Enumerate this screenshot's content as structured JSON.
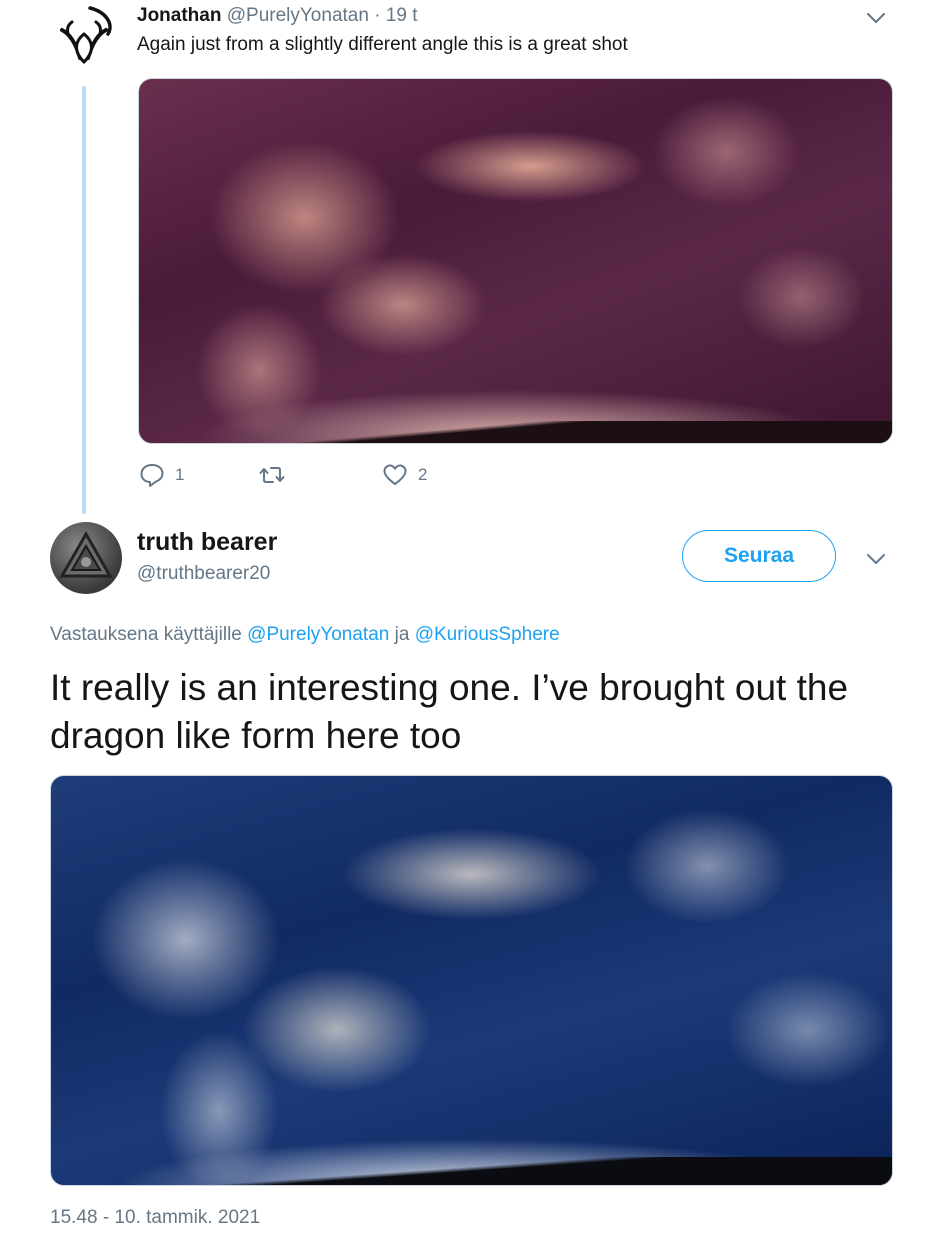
{
  "parent_tweet": {
    "name": "Jonathan",
    "handle": "@PurelyYonatan",
    "separator": "·",
    "time": "19 t",
    "text": "Again just from a slightly different angle this is a great shot",
    "reply_count": "1",
    "like_count": "2",
    "media_subject": "sky photograph of wispy clouds"
  },
  "reply_tweet": {
    "name": "truth bearer",
    "handle": "@truthbearer20",
    "follow_label": "Seuraa",
    "reply_to_prefix": "Vastauksena käyttäjille",
    "reply_to_mention_1": "@PurelyYonatan",
    "reply_to_joiner": "ja",
    "reply_to_mention_2": "@KuriousSphere",
    "text": "It really is an interesting one. I’ve brought out the dragon like form here too",
    "timestamp": "15.48 - 10. tammik. 2021",
    "media_subject": "sky photograph of wispy clouds"
  },
  "colors": {
    "accent": "#1da1f2",
    "secondary_text": "#657786",
    "thread_line": "#b7dcf6"
  },
  "icons": [
    "alien-logo-icon",
    "chevron-down-icon",
    "reply-icon",
    "retweet-icon",
    "like-icon"
  ]
}
